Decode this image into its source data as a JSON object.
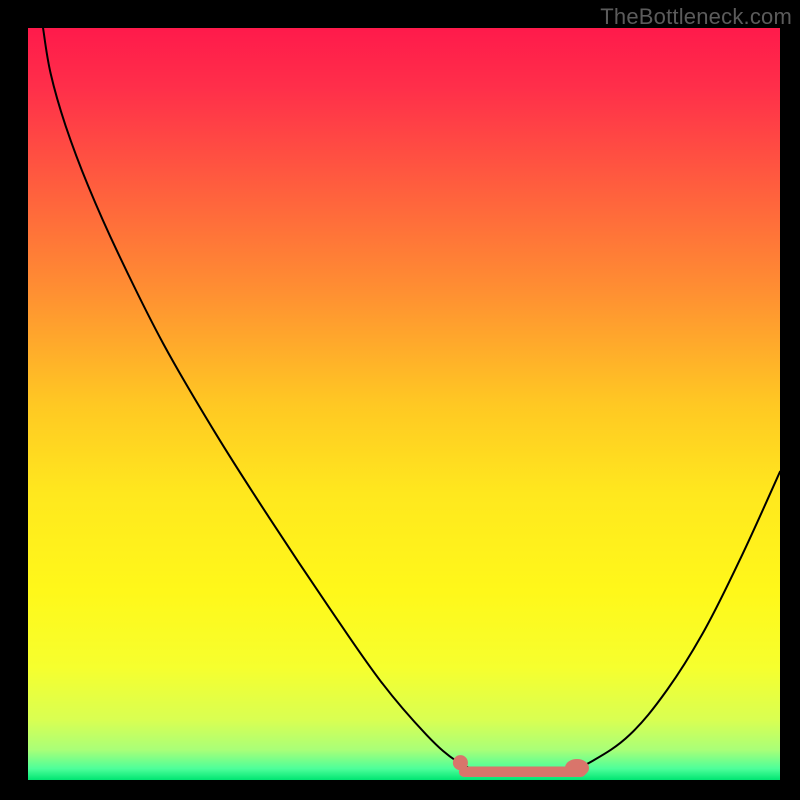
{
  "watermark": "TheBottleneck.com",
  "chart_data": {
    "type": "line",
    "title": "",
    "xlabel": "",
    "ylabel": "",
    "xlim": [
      0,
      100
    ],
    "ylim": [
      0,
      100
    ],
    "background_gradient": {
      "stops": [
        {
          "offset": 0.0,
          "color": "#ff1a4b"
        },
        {
          "offset": 0.08,
          "color": "#ff2f4a"
        },
        {
          "offset": 0.2,
          "color": "#ff5a3f"
        },
        {
          "offset": 0.35,
          "color": "#ff8f32"
        },
        {
          "offset": 0.5,
          "color": "#ffc823"
        },
        {
          "offset": 0.62,
          "color": "#ffe81e"
        },
        {
          "offset": 0.75,
          "color": "#fff81a"
        },
        {
          "offset": 0.85,
          "color": "#f6ff2e"
        },
        {
          "offset": 0.92,
          "color": "#d9ff52"
        },
        {
          "offset": 0.96,
          "color": "#a9ff78"
        },
        {
          "offset": 0.985,
          "color": "#4dff9a"
        },
        {
          "offset": 1.0,
          "color": "#00e572"
        }
      ]
    },
    "series": [
      {
        "name": "bottleneck-curve",
        "stroke": "#000000",
        "stroke_width": 2,
        "points": [
          {
            "x": 2.0,
            "y": 100.0
          },
          {
            "x": 3.0,
            "y": 94.0
          },
          {
            "x": 5.0,
            "y": 87.0
          },
          {
            "x": 8.0,
            "y": 79.0
          },
          {
            "x": 12.0,
            "y": 70.0
          },
          {
            "x": 18.0,
            "y": 58.0
          },
          {
            "x": 25.0,
            "y": 46.0
          },
          {
            "x": 32.0,
            "y": 35.0
          },
          {
            "x": 40.0,
            "y": 23.0
          },
          {
            "x": 47.0,
            "y": 13.0
          },
          {
            "x": 53.0,
            "y": 6.0
          },
          {
            "x": 57.0,
            "y": 2.5
          },
          {
            "x": 60.0,
            "y": 1.3
          },
          {
            "x": 64.0,
            "y": 0.9
          },
          {
            "x": 68.0,
            "y": 0.9
          },
          {
            "x": 72.0,
            "y": 1.4
          },
          {
            "x": 75.0,
            "y": 2.5
          },
          {
            "x": 80.0,
            "y": 6.0
          },
          {
            "x": 85.0,
            "y": 12.0
          },
          {
            "x": 90.0,
            "y": 20.0
          },
          {
            "x": 95.0,
            "y": 30.0
          },
          {
            "x": 100.0,
            "y": 41.0
          }
        ]
      }
    ],
    "markers": {
      "name": "highlight-range",
      "color": "#d9756b",
      "dot": {
        "x": 57.5,
        "y": 2.3,
        "r": 1.0
      },
      "bar": {
        "x_start": 58.0,
        "x_end": 73.5,
        "y": 1.1,
        "thickness": 1.4
      },
      "end_blob": {
        "cx": 73.0,
        "cy": 1.6,
        "rx": 1.6,
        "ry": 1.2
      }
    }
  }
}
